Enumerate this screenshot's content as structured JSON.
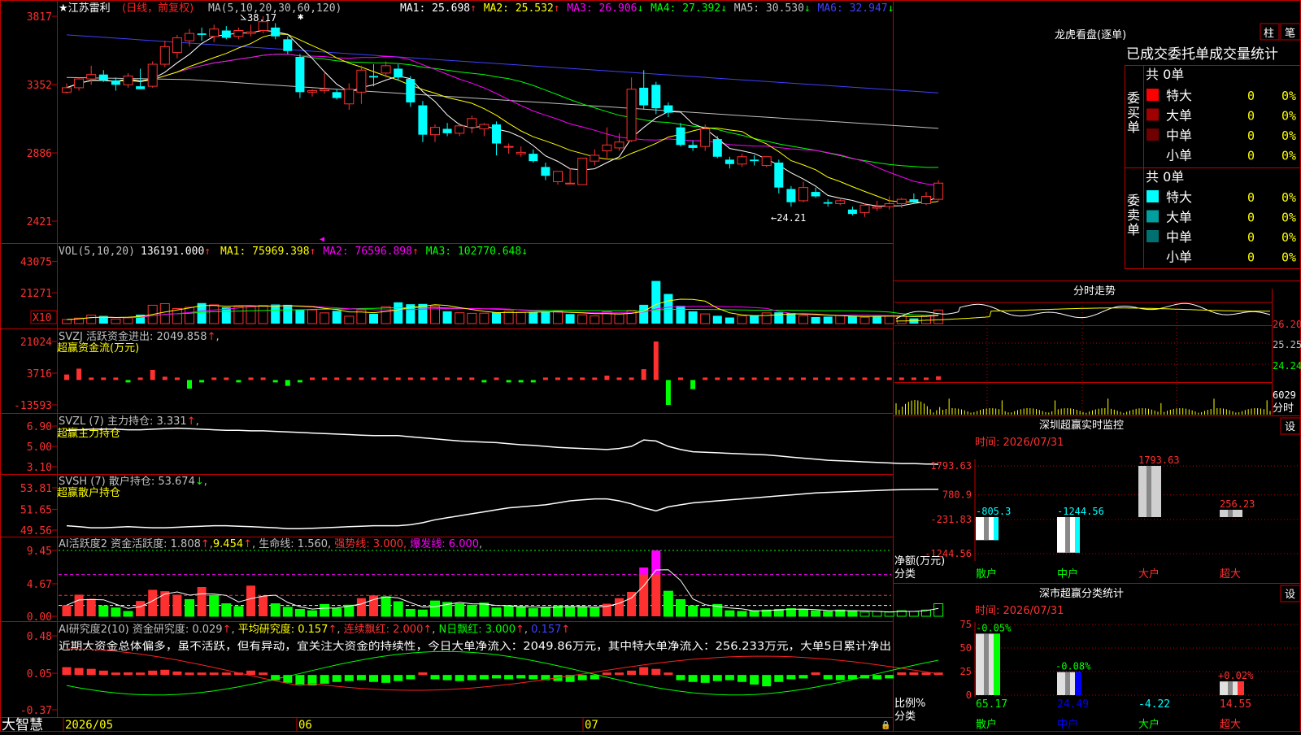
{
  "app_name": "大智慧",
  "main_panel": {
    "stock_name": "江苏雷利",
    "period_label": "(日线，前复权)",
    "ma_title": "MA(5,10,20,30,60,120)",
    "ma_items": [
      {
        "label": "MA1: 25.698",
        "arrow": "↑",
        "color": "#ffffff"
      },
      {
        "label": "MA2: 25.532",
        "arrow": "↑",
        "color": "#ffff00"
      },
      {
        "label": "MA3: 26.906",
        "arrow": "↓",
        "color": "#ff00ff"
      },
      {
        "label": "MA4: 27.392",
        "arrow": "↓",
        "color": "#00ff00"
      },
      {
        "label": "MA5: 30.530",
        "arrow": "↓",
        "color": "#c0c0c0"
      },
      {
        "label": "MA6: 32.947",
        "arrow": "↓",
        "color": "#4040ff"
      }
    ],
    "y_ticks": [
      "3817",
      "3352",
      "2886",
      "2421"
    ],
    "high_label": "38.17",
    "low_label": "24.21"
  },
  "vol_panel": {
    "title": "VOL(5,10,20)",
    "value": "136191.000",
    "value_arrow": "↑",
    "ma_items": [
      {
        "label": "MA1: 75969.398",
        "arrow": "↑",
        "color": "#ffff00"
      },
      {
        "label": "MA2: 76596.898",
        "arrow": "↑",
        "color": "#ff00ff"
      },
      {
        "label": "MA3: 102770.648",
        "arrow": "↓",
        "color": "#00ff00"
      }
    ],
    "y_ticks": [
      "43075",
      "21271"
    ],
    "unit": "X10"
  },
  "svzj_panel": {
    "title": "SVZJ  活跃资金进出: 2049.858",
    "arrow": "↑",
    "subtitle": "超赢资金流(万元)",
    "y_ticks": [
      "21024",
      "3716",
      "-13593"
    ]
  },
  "svzl_panel": {
    "title": "SVZL (7) 主力持仓: 3.331",
    "arrow": "↑",
    "subtitle": "超赢主力持仓",
    "y_ticks": [
      "6.90",
      "5.00",
      "3.10"
    ]
  },
  "svsh_panel": {
    "title": "SVSH (7) 散户持仓: 53.674",
    "arrow": "↓",
    "subtitle": "超赢散户持仓",
    "y_ticks": [
      "53.81",
      "51.65",
      "49.56"
    ]
  },
  "ai2_panel": {
    "title": "AI活跃度2 资金活跃度: 1.808",
    "arrow": "↑",
    "extra1": "9.454",
    "extra2": "生命线: 1.560",
    "extra3": "强势线: 3.000",
    "extra4": "爆发线: 6.000",
    "y_ticks": [
      "9.45",
      "4.67",
      "0.00"
    ]
  },
  "ai_research_panel": {
    "title": "AI研究度2(10) 资金研究度: 0.029",
    "arrow": "↑",
    "avg": "平均研究度: 0.157",
    "cont": "连续飘红: 2.000",
    "nday": "N日飘红: 3.000",
    "last": "0.157",
    "comment": "近期大资金总体偏多，虽不活跃，但有异动，宜关注大资金的持续性，今日大单净流入：2049.86万元，其中特大单净流入：256.233万元，大单5日累计净出",
    "y_ticks": [
      "0.48",
      "0.05",
      "-0.37"
    ]
  },
  "x_axis": {
    "labels": [
      "2026/05",
      "06",
      "07"
    ]
  },
  "dragon_tiger": {
    "title": "龙虎看盘(逐单)",
    "btn_bar": "柱",
    "btn_pen": "笔",
    "header": "已成交委托单成交量统计",
    "buy_label": "委买单",
    "sell_label": "委卖单",
    "buy_total": "共 0单",
    "sell_total": "共 0单",
    "buy_rows": [
      {
        "name": "特大",
        "count": "0",
        "pct": "0%",
        "color": "#ff0000"
      },
      {
        "name": "大单",
        "count": "0",
        "pct": "0%",
        "color": "#a00000"
      },
      {
        "name": "中单",
        "count": "0",
        "pct": "0%",
        "color": "#700000"
      },
      {
        "name": "小单",
        "count": "0",
        "pct": "0%",
        "color": ""
      }
    ],
    "sell_rows": [
      {
        "name": "特大",
        "count": "0",
        "pct": "0%",
        "color": "#00ffff"
      },
      {
        "name": "大单",
        "count": "0",
        "pct": "0%",
        "color": "#00a0a0"
      },
      {
        "name": "中单",
        "count": "0",
        "pct": "0%",
        "color": "#007070"
      },
      {
        "name": "小单",
        "count": "0",
        "pct": "0%",
        "color": ""
      }
    ]
  },
  "intraday": {
    "title": "分时走势",
    "y_ticks": [
      "26.20",
      "25.25",
      "24.24"
    ],
    "vol_tick": "6029",
    "vol_unit": "分时"
  },
  "sz_monitor": {
    "title": "深圳超赢实时监控",
    "settings": "设",
    "time": "时间: 2026/07/31",
    "y_ticks": [
      "1793.63",
      "780.9",
      "-231.83",
      "-1244.56"
    ],
    "ylabel": "净额(万元)",
    "xlabel": "分类",
    "categories": [
      "散户",
      "中户",
      "大户",
      "超大"
    ],
    "values": [
      "-805.3",
      "-1244.56",
      "1793.63",
      "256.23"
    ]
  },
  "sz_class": {
    "title": "深市超赢分类统计",
    "settings": "设",
    "time": "时间: 2026/07/31",
    "y_ticks": [
      "75",
      "50",
      "25",
      "0"
    ],
    "ylabel": "比例%",
    "xlabel": "分类",
    "categories": [
      "散户",
      "中户",
      "大户",
      "超大"
    ],
    "top_labels": [
      "-0.05%",
      "-0.08%",
      "",
      "+0.02%"
    ],
    "values": [
      "65.17",
      "24.49",
      "-4.22",
      "14.55"
    ]
  },
  "chart_data": [
    {
      "type": "candlestick",
      "title": "江苏雷利",
      "ylim": [
        24.21,
        38.17
      ],
      "ohlc": [
        [
          33.0,
          33.6,
          32.9,
          33.3
        ],
        [
          33.3,
          34.0,
          33.1,
          33.9
        ],
        [
          33.9,
          34.8,
          33.5,
          34.2
        ],
        [
          34.2,
          34.5,
          33.7,
          33.8
        ],
        [
          33.8,
          34.0,
          33.1,
          33.5
        ],
        [
          33.5,
          34.3,
          33.3,
          34.1
        ],
        [
          33.4,
          34.6,
          33.2,
          33.2
        ],
        [
          33.4,
          35.1,
          33.3,
          34.9
        ],
        [
          34.9,
          36.5,
          34.7,
          36.1
        ],
        [
          35.7,
          36.9,
          35.3,
          36.7
        ],
        [
          36.5,
          37.3,
          36.1,
          37.0
        ],
        [
          37.0,
          37.4,
          36.5,
          36.9
        ],
        [
          36.8,
          37.6,
          36.4,
          37.3
        ],
        [
          37.2,
          37.5,
          36.6,
          36.7
        ],
        [
          36.8,
          37.4,
          36.6,
          37.2
        ],
        [
          37.0,
          37.6,
          36.8,
          37.1
        ],
        [
          37.2,
          38.17,
          37.0,
          37.8
        ],
        [
          37.4,
          37.7,
          36.6,
          36.8
        ],
        [
          36.6,
          36.8,
          35.6,
          35.8
        ],
        [
          35.4,
          35.6,
          32.6,
          33.0
        ],
        [
          33.0,
          33.2,
          32.7,
          33.1
        ],
        [
          33.1,
          34.3,
          32.9,
          33.2
        ],
        [
          33.0,
          33.2,
          32.5,
          32.6
        ],
        [
          32.2,
          33.6,
          31.8,
          33.2
        ],
        [
          33.0,
          34.8,
          32.2,
          34.5
        ],
        [
          34.1,
          34.9,
          33.4,
          34.0
        ],
        [
          34.3,
          35.1,
          34.0,
          34.8
        ],
        [
          34.6,
          34.9,
          33.8,
          34.0
        ],
        [
          33.9,
          34.1,
          32.0,
          32.3
        ],
        [
          32.1,
          32.4,
          29.6,
          30.1
        ],
        [
          30.1,
          30.8,
          29.6,
          30.6
        ],
        [
          30.5,
          30.9,
          30.0,
          30.2
        ],
        [
          30.2,
          30.9,
          30.0,
          30.7
        ],
        [
          30.6,
          31.4,
          30.2,
          31.2
        ],
        [
          30.5,
          30.9,
          30.0,
          30.8
        ],
        [
          30.8,
          31.0,
          28.7,
          29.5
        ],
        [
          29.3,
          29.5,
          28.8,
          29.3
        ],
        [
          28.8,
          29.3,
          28.6,
          28.9
        ],
        [
          28.8,
          29.1,
          28.2,
          28.3
        ],
        [
          27.9,
          28.2,
          27.0,
          27.3
        ],
        [
          26.9,
          27.6,
          26.7,
          27.6
        ],
        [
          26.8,
          27.8,
          26.8,
          26.8
        ],
        [
          26.7,
          28.5,
          26.7,
          28.5
        ],
        [
          28.3,
          29.1,
          28.0,
          28.7
        ],
        [
          29.0,
          30.6,
          28.4,
          29.4
        ],
        [
          29.2,
          30.2,
          29.0,
          29.6
        ],
        [
          29.7,
          34.0,
          29.6,
          33.2
        ],
        [
          33.3,
          34.5,
          31.8,
          32.1
        ],
        [
          33.5,
          33.7,
          31.5,
          31.9
        ],
        [
          32.1,
          32.3,
          31.3,
          31.6
        ],
        [
          30.6,
          30.9,
          29.3,
          29.4
        ],
        [
          29.4,
          29.7,
          29.0,
          29.2
        ],
        [
          29.3,
          30.8,
          29.0,
          30.5
        ],
        [
          29.8,
          30.0,
          28.5,
          28.6
        ],
        [
          28.4,
          28.6,
          27.8,
          28.1
        ],
        [
          28.1,
          28.8,
          27.9,
          28.6
        ],
        [
          28.4,
          28.7,
          28.0,
          28.3
        ],
        [
          28.0,
          28.6,
          27.9,
          28.6
        ],
        [
          28.2,
          28.4,
          26.1,
          26.5
        ],
        [
          26.4,
          26.6,
          25.2,
          25.5
        ],
        [
          25.6,
          26.9,
          25.5,
          26.5
        ],
        [
          26.2,
          26.5,
          25.8,
          25.9
        ],
        [
          25.5,
          25.7,
          25.2,
          25.4
        ],
        [
          25.4,
          25.7,
          25.3,
          25.6
        ],
        [
          25.0,
          25.2,
          24.6,
          24.7
        ],
        [
          24.8,
          25.4,
          24.5,
          25.3
        ],
        [
          25.1,
          25.6,
          24.9,
          25.2
        ],
        [
          25.2,
          25.9,
          25.0,
          25.4
        ],
        [
          25.4,
          25.8,
          25.1,
          25.7
        ],
        [
          25.7,
          26.1,
          25.4,
          25.5
        ],
        [
          25.4,
          26.2,
          25.3,
          25.9
        ],
        [
          25.7,
          27.0,
          25.6,
          26.8
        ]
      ]
    },
    {
      "type": "bar",
      "title": "VOL",
      "ylim": [
        0,
        45000
      ],
      "values": [
        2800,
        3800,
        5900,
        5300,
        3200,
        4000,
        6200,
        12700,
        13800,
        10400,
        11300,
        14200,
        13000,
        11300,
        11800,
        11600,
        12600,
        13200,
        13000,
        9800,
        9500,
        7400,
        8800,
        5100,
        9500,
        6800,
        11700,
        14700,
        13400,
        13600,
        12100,
        8500,
        7500,
        7100,
        7200,
        7700,
        8700,
        7800,
        8000,
        8200,
        8400,
        6600,
        6100,
        5300,
        8200,
        6700,
        9100,
        13000,
        29500,
        20500,
        12300,
        8500,
        6700,
        5400,
        4200,
        5400,
        5700,
        7400,
        7800,
        7300,
        5500,
        4500,
        4800,
        5600,
        5300,
        4400,
        5100,
        5300,
        5400,
        3600,
        5700,
        9400
      ],
      "up": [
        1,
        1,
        1,
        0,
        1,
        1,
        0,
        1,
        1,
        1,
        1,
        0,
        1,
        0,
        1,
        1,
        1,
        0,
        0,
        0,
        1,
        1,
        0,
        1,
        1,
        0,
        1,
        0,
        0,
        0,
        1,
        0,
        1,
        1,
        1,
        0,
        1,
        1,
        0,
        0,
        1,
        0,
        1,
        1,
        1,
        1,
        1,
        0,
        0,
        0,
        0,
        0,
        1,
        0,
        0,
        1,
        0,
        1,
        0,
        0,
        1,
        0,
        0,
        1,
        0,
        1,
        0,
        1,
        1,
        0,
        1,
        1
      ]
    },
    {
      "type": "bar",
      "title": "SVZJ",
      "ylim": [
        -13593,
        21024
      ],
      "values": [
        3000,
        6200,
        0,
        0,
        0,
        -600,
        0,
        5500,
        1800,
        0,
        -4700,
        -600,
        0,
        0,
        -500,
        0,
        0,
        -500,
        -3200,
        -400,
        0,
        0,
        0,
        500,
        0,
        0,
        0,
        0,
        0,
        0,
        0,
        0,
        0,
        0,
        -500,
        0,
        -1200,
        -600,
        -700,
        0,
        0,
        0,
        0,
        0,
        2400,
        0,
        0,
        5900,
        21024,
        -13593,
        0,
        -5000,
        0,
        0,
        0,
        0,
        0,
        0,
        400,
        0,
        0,
        0,
        0,
        0,
        0,
        0,
        0,
        0,
        0,
        0,
        0,
        2049.858
      ]
    },
    {
      "type": "line",
      "title": "SVZL",
      "ylim": [
        3.1,
        6.9
      ],
      "values": [
        6.5,
        6.55,
        6.6,
        6.62,
        6.6,
        6.55,
        6.55,
        6.6,
        6.65,
        6.7,
        6.65,
        6.6,
        6.55,
        6.5,
        6.5,
        6.45,
        6.45,
        6.4,
        6.35,
        6.3,
        6.25,
        6.2,
        6.15,
        6.1,
        6.05,
        6.0,
        6.0,
        6.0,
        5.9,
        5.8,
        5.7,
        5.6,
        5.5,
        5.45,
        5.4,
        5.35,
        5.25,
        5.15,
        5.1,
        5.0,
        4.9,
        4.85,
        4.8,
        4.75,
        4.7,
        4.8,
        5.0,
        5.6,
        5.5,
        5.0,
        4.7,
        4.5,
        4.45,
        4.4,
        4.35,
        4.3,
        4.25,
        4.2,
        4.1,
        4.0,
        3.9,
        3.8,
        3.7,
        3.65,
        3.6,
        3.55,
        3.5,
        3.45,
        3.4,
        3.4,
        3.35,
        3.33
      ]
    },
    {
      "type": "line",
      "title": "SVSH",
      "ylim": [
        49.56,
        53.81
      ],
      "values": [
        50.0,
        49.9,
        49.8,
        49.8,
        49.85,
        49.9,
        49.85,
        49.8,
        49.8,
        49.85,
        49.9,
        49.95,
        50.0,
        50.0,
        49.95,
        49.9,
        49.85,
        49.8,
        49.7,
        49.7,
        49.75,
        49.8,
        49.85,
        49.9,
        49.95,
        50.0,
        50.0,
        50.0,
        50.1,
        50.3,
        50.6,
        50.8,
        51.0,
        51.2,
        51.4,
        51.6,
        51.8,
        51.9,
        52.0,
        52.1,
        52.3,
        52.5,
        52.6,
        52.7,
        52.7,
        52.5,
        52.2,
        51.8,
        51.5,
        51.9,
        52.1,
        52.3,
        52.4,
        52.5,
        52.6,
        52.7,
        52.8,
        52.9,
        53.0,
        53.1,
        53.2,
        53.3,
        53.35,
        53.4,
        53.45,
        53.5,
        53.55,
        53.6,
        53.62,
        53.65,
        53.67,
        53.674
      ]
    },
    {
      "type": "bar",
      "title": "AI活跃度2",
      "ylim": [
        0,
        9.45
      ],
      "values": [
        1.6,
        3.1,
        2.5,
        1.5,
        1.2,
        0.7,
        2.2,
        3.8,
        3.6,
        3.1,
        2.4,
        4.2,
        3.0,
        1.8,
        1.4,
        4.4,
        2.9,
        1.8,
        1.3,
        1.0,
        0.8,
        1.7,
        1.1,
        1.6,
        2.6,
        3.0,
        2.8,
        2.1,
        1.0,
        0.9,
        2.2,
        2.0,
        1.8,
        1.6,
        1.9,
        1.2,
        1.5,
        1.4,
        1.1,
        1.3,
        1.5,
        1.4,
        1.3,
        1.2,
        1.8,
        2.6,
        3.5,
        7.0,
        9.45,
        3.6,
        2.4,
        1.5,
        1.1,
        1.7,
        0.8,
        0.7,
        0.8,
        0.9,
        1.0,
        1.1,
        1.0,
        0.8,
        0.7,
        0.9,
        0.8,
        0.6,
        0.7,
        0.6,
        0.8,
        0.7,
        0.9,
        1.808
      ],
      "up": [
        1,
        1,
        1,
        0,
        0,
        0,
        1,
        1,
        1,
        1,
        0,
        1,
        0,
        0,
        0,
        1,
        1,
        0,
        0,
        0,
        0,
        0,
        0,
        0,
        1,
        1,
        0,
        0,
        0,
        0,
        0,
        0,
        0,
        0,
        0,
        0,
        0,
        0,
        0,
        0,
        0,
        0,
        0,
        0,
        1,
        1,
        1,
        1,
        1,
        0,
        0,
        0,
        0,
        0,
        0,
        0,
        0,
        0,
        0,
        0,
        0,
        0,
        0,
        0,
        0,
        0,
        0,
        0,
        0,
        0,
        0,
        0
      ]
    },
    {
      "type": "bar",
      "title": "AI研究度2",
      "ylim": [
        -0.37,
        0.48
      ],
      "values": [
        0.12,
        0.11,
        0.1,
        0.08,
        0.04,
        0.0,
        0.01,
        0.08,
        0.09,
        0.07,
        0.05,
        0.04,
        0.02,
        0.01,
        0.03,
        0.08,
        0.05,
        -0.03,
        -0.06,
        -0.08,
        -0.09,
        -0.07,
        -0.05,
        -0.04,
        -0.03,
        -0.05,
        -0.06,
        -0.04,
        -0.02,
        0.0,
        -0.02,
        -0.03,
        -0.04,
        -0.03,
        -0.02,
        -0.01,
        -0.02,
        -0.01,
        -0.02,
        -0.03,
        -0.04,
        -0.05,
        -0.03,
        -0.02,
        0.03,
        0.05,
        0.08,
        0.12,
        0.1,
        0.02,
        -0.03,
        -0.05,
        -0.06,
        -0.04,
        -0.03,
        -0.05,
        -0.08,
        -0.1,
        -0.05,
        -0.02,
        -0.01,
        0.0,
        -0.02,
        -0.03,
        -0.02,
        -0.01,
        -0.02,
        -0.01,
        0.0,
        0.0,
        0.01,
        0.029
      ]
    }
  ]
}
